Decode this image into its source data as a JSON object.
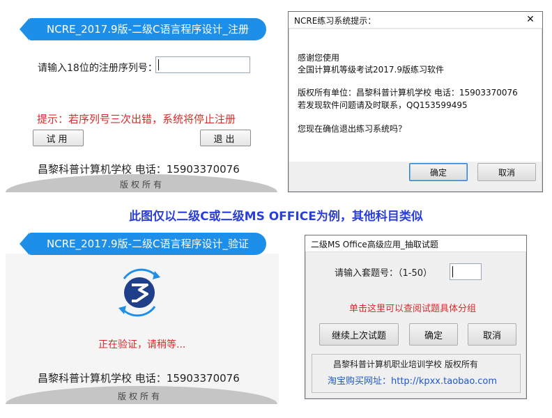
{
  "register_panel": {
    "title": "NCRE_2017.9版-二级C语言程序设计_注册",
    "prompt_label": "请输入18位的注册序列号：",
    "serial_input_value": "",
    "warning": "提示：若序列号三次出错，系统将停止注册",
    "trial_button": "试用",
    "exit_button": "退出",
    "footer_contact": "昌黎科普计算机学校  电话：15903370076",
    "rights": "版权所有"
  },
  "exit_dialog": {
    "title": "NCRE练习系统提示：",
    "lines": [
      "感谢您使用",
      "全国计算机等级考试2017.9版练习软件",
      "版权所有单位：昌黎科普计算机学校  电话：15903370076",
      "若发现软件问题请及时联系，QQ153599495",
      "您现在确信退出练习系统吗？"
    ],
    "ok_button": "确定",
    "cancel_button": "取消"
  },
  "caption": "此图仅以二级C或二级MS OFFICE为例，其他科目类似",
  "verify_panel": {
    "title": "NCRE_2017.9版-二级C语言程序设计_验证",
    "status": "正在验证，请稍等...",
    "footer_contact": "昌黎科普计算机学校  电话：15903370076",
    "rights": "版权所有"
  },
  "office_dialog": {
    "title": "二级MS Office高级应用_抽取试题",
    "prompt_label": "请输入套题号：（1-50）",
    "set_input_value": "",
    "link": "单击这里可以查阅试题具体分组",
    "continue_button": "继续上次试题",
    "ok_button": "确定",
    "cancel_button": "取消",
    "footer_school": "昌黎科普计算机职业培训学校  版权所有",
    "footer_shop": "淘宝购买网址：http://kpxx.taobao.com"
  },
  "colors": {
    "ribbon_blue": "#1e8fe8",
    "warning_red": "#d72b2b",
    "caption_blue": "#2a3fd6",
    "logo_navy": "#1f3f8a"
  }
}
